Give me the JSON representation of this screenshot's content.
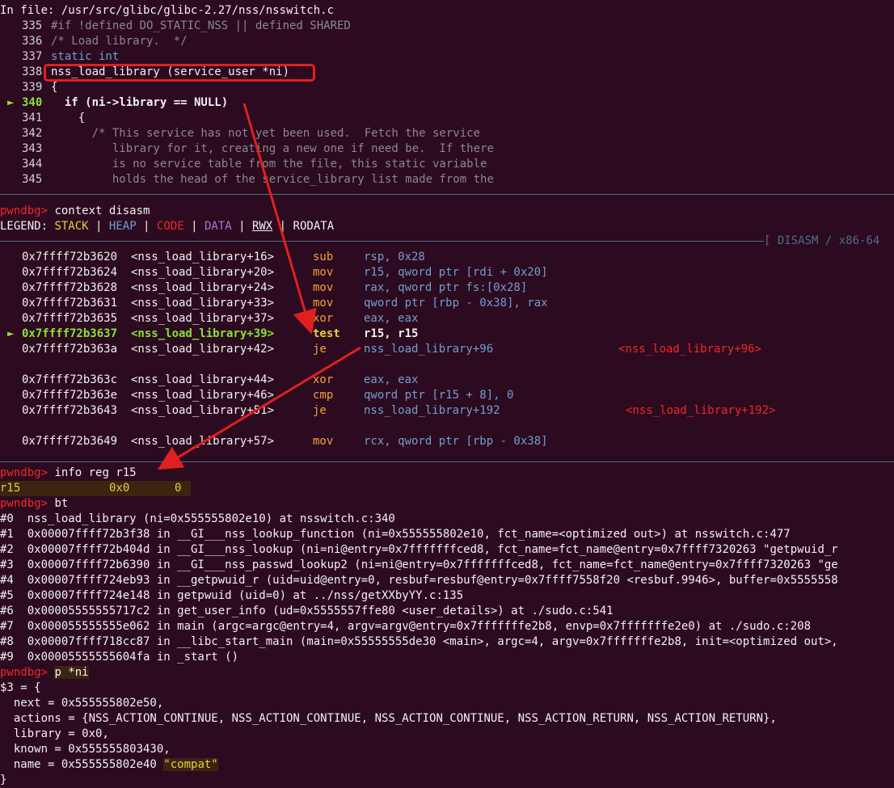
{
  "source": {
    "file_line": "In file: /usr/src/glibc/glibc-2.27/nss/nsswitch.c",
    "lines": [
      {
        "no": "335",
        "code": "#if !defined DO_STATIC_NSS || defined SHARED"
      },
      {
        "no": "336",
        "code": "/* Load library.  */"
      },
      {
        "no": "337",
        "code": "static int"
      },
      {
        "no": "338",
        "code": "nss_load_library (service_user *ni)"
      },
      {
        "no": "339",
        "code": "{"
      },
      {
        "no": "340",
        "code": "  if (ni->library == NULL)"
      },
      {
        "no": "341",
        "code": "    {"
      },
      {
        "no": "342",
        "code": "      /* This service has not yet been used.  Fetch the service"
      },
      {
        "no": "343",
        "code": "         library for it, creating a new one if need be.  If there"
      },
      {
        "no": "344",
        "code": "         is no service table from the file, this static variable"
      },
      {
        "no": "345",
        "code": "         holds the head of the service_library list made from the"
      }
    ],
    "current_marker": "►"
  },
  "prompt": "pwndbg>",
  "cmd1": "context disasm",
  "legend": {
    "label": "LEGEND:",
    "stack": "STACK",
    "heap": "HEAP",
    "code": "CODE",
    "data": "DATA",
    "rwx": "RWX",
    "rodata": "RODATA",
    "bar": " | "
  },
  "disasm_header": "[ DISASM / x86-64",
  "disasm": [
    {
      "addr": "0x7ffff72b3620",
      "sym": "<nss_load_library+16>",
      "op": "sub",
      "args": "rsp, 0x28"
    },
    {
      "addr": "0x7ffff72b3624",
      "sym": "<nss_load_library+20>",
      "op": "mov",
      "args": "r15, qword ptr [rdi + 0x20]"
    },
    {
      "addr": "0x7ffff72b3628",
      "sym": "<nss_load_library+24>",
      "op": "mov",
      "args": "rax, qword ptr fs:[0x28]"
    },
    {
      "addr": "0x7ffff72b3631",
      "sym": "<nss_load_library+33>",
      "op": "mov",
      "args": "qword ptr [rbp - 0x38], rax"
    },
    {
      "addr": "0x7ffff72b3635",
      "sym": "<nss_load_library+37>",
      "op": "xor",
      "args": "eax, eax"
    },
    {
      "addr": "0x7ffff72b3637",
      "sym": "<nss_load_library+39>",
      "op": "test",
      "args": "r15, r15"
    },
    {
      "addr": "0x7ffff72b363a",
      "sym": "<nss_load_library+42>",
      "op": "je",
      "args": "nss_load_library+96",
      "target": "<nss_load_library+96>"
    },
    {
      "addr": "0x7ffff72b363c",
      "sym": "<nss_load_library+44>",
      "op": "xor",
      "args": "eax, eax"
    },
    {
      "addr": "0x7ffff72b363e",
      "sym": "<nss_load_library+46>",
      "op": "cmp",
      "args": "qword ptr [r15 + 8], 0"
    },
    {
      "addr": "0x7ffff72b3643",
      "sym": "<nss_load_library+51>",
      "op": "je",
      "args": "nss_load_library+192",
      "target": "<nss_load_library+192>"
    },
    {
      "addr": "0x7ffff72b3649",
      "sym": "<nss_load_library+57>",
      "op": "mov",
      "args": "rcx, qword ptr [rbp - 0x38]"
    }
  ],
  "cmd2": "info reg r15",
  "reg": {
    "name": "r15",
    "hex": "0x0",
    "dec": "0"
  },
  "cmd3": "bt",
  "bt": [
    "#0  nss_load_library (ni=0x555555802e10) at nsswitch.c:340",
    "#1  0x00007ffff72b3f38 in __GI___nss_lookup_function (ni=0x555555802e10, fct_name=<optimized out>) at nsswitch.c:477",
    "#2  0x00007ffff72b404d in __GI___nss_lookup (ni=ni@entry=0x7fffffffced8, fct_name=fct_name@entry=0x7ffff7320263 \"getpwuid_r",
    "#3  0x00007ffff72b6390 in __GI___nss_passwd_lookup2 (ni=ni@entry=0x7fffffffced8, fct_name=fct_name@entry=0x7ffff7320263 \"ge",
    "#4  0x00007ffff724eb93 in __getpwuid_r (uid=uid@entry=0, resbuf=resbuf@entry=0x7ffff7558f20 <resbuf.9946>, buffer=0x5555558",
    "#5  0x00007ffff724e148 in getpwuid (uid=0) at ../nss/getXXbyYY.c:135",
    "#6  0x00005555555717c2 in get_user_info (ud=0x5555557ffe80 <user_details>) at ./sudo.c:541",
    "#7  0x000055555555e062 in main (argc=argc@entry=4, argv=argv@entry=0x7fffffffe2b8, envp=0x7fffffffe2e0) at ./sudo.c:208",
    "#8  0x00007ffff718cc87 in __libc_start_main (main=0x55555555de30 <main>, argc=4, argv=0x7fffffffe2b8, init=<optimized out>,",
    "#9  0x00005555555604fa in _start ()"
  ],
  "cmd4": "p *ni",
  "struct": {
    "open": "$3 = {",
    "next": "  next = 0x555555802e50,",
    "actions": "  actions = {NSS_ACTION_CONTINUE, NSS_ACTION_CONTINUE, NSS_ACTION_CONTINUE, NSS_ACTION_RETURN, NSS_ACTION_RETURN},",
    "library": "  library = 0x0,",
    "known": "  known = 0x555555803430,",
    "name_pre": "  name = 0x555555802e40 ",
    "name_str": "\"compat\"",
    "close": "}"
  },
  "colors": {
    "background": "#2c0a1f",
    "annotation": "#e02020",
    "separator": "#4e6e88"
  }
}
